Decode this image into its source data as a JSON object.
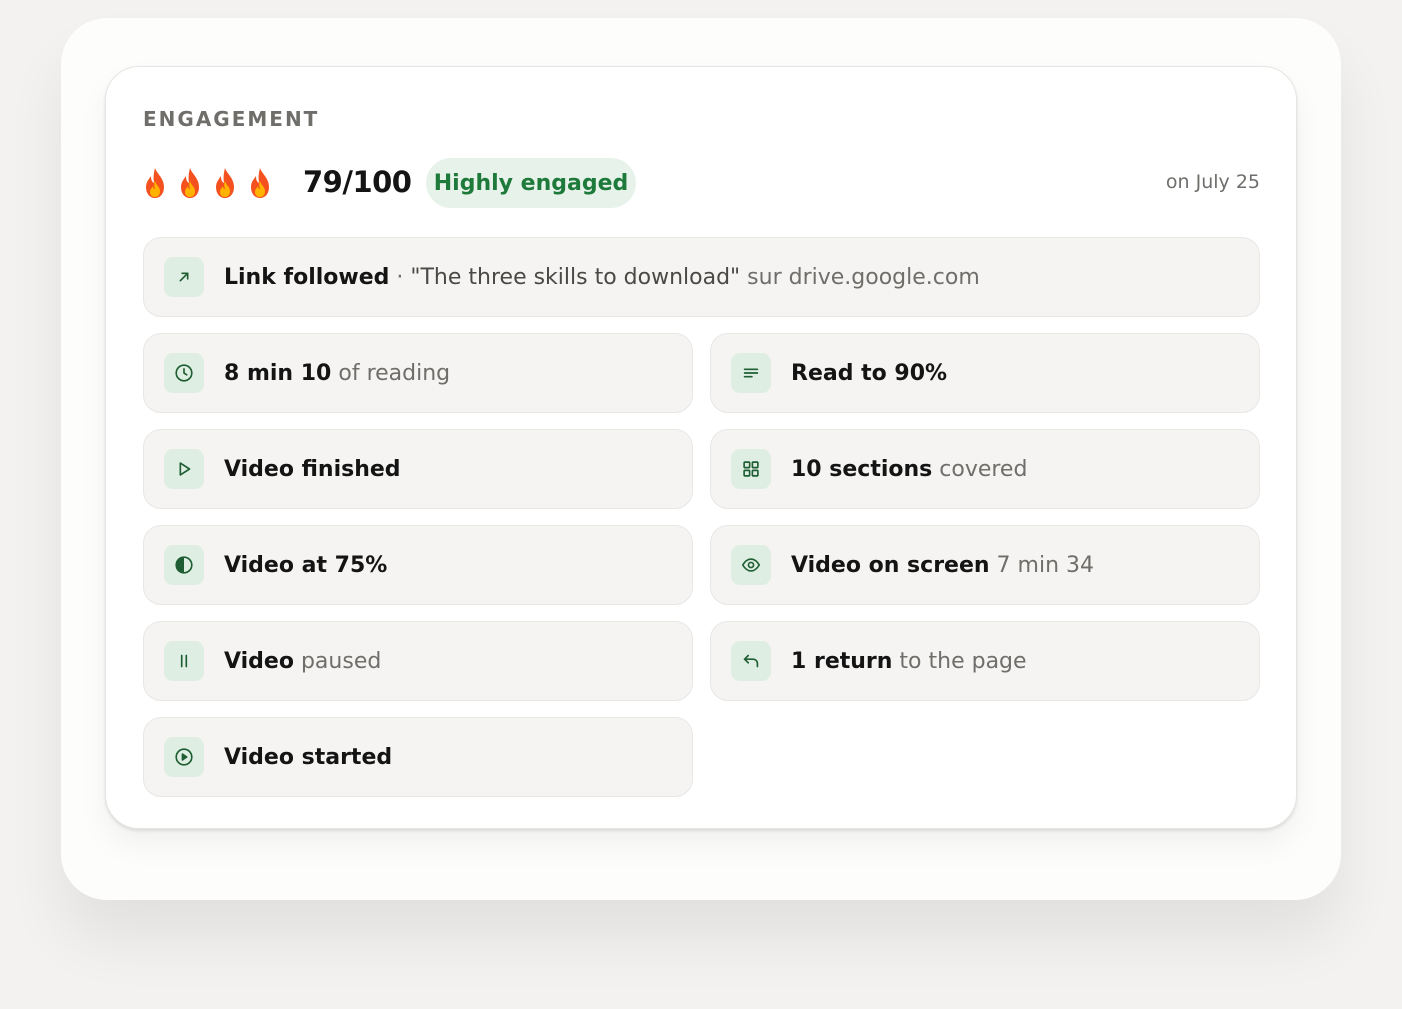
{
  "engagement": {
    "label": "ENGAGEMENT",
    "flames": [
      "fire-icon",
      "fire-icon",
      "fire-icon",
      "fire-icon"
    ],
    "score": "79/100",
    "badge": "Highly engaged",
    "date": "on July 25"
  },
  "link": {
    "icon": "arrow-up-right-icon",
    "label": "Link followed",
    "separator": " · ",
    "quote": "\"The three skills to download\"",
    "suffix": " sur drive.google.com"
  },
  "items": [
    {
      "icon": "clock-icon",
      "bold": "8 min 10",
      "rest": " of reading"
    },
    {
      "icon": "lines-icon",
      "bold": "Read to 90%",
      "rest": ""
    },
    {
      "icon": "play-icon",
      "bold": "Video finished",
      "rest": ""
    },
    {
      "icon": "grid-icon",
      "bold": "10 sections",
      "rest": " covered"
    },
    {
      "icon": "half-circle-icon",
      "bold": "Video at 75%",
      "rest": ""
    },
    {
      "icon": "eye-icon",
      "bold": "Video on screen",
      "rest": " 7 min 34"
    },
    {
      "icon": "pause-icon",
      "bold": "Video",
      "rest": " paused"
    },
    {
      "icon": "return-arrow-icon",
      "bold": "1 return",
      "rest": " to the page"
    },
    {
      "icon": "play-circle-icon",
      "bold": "Video started",
      "rest": ""
    }
  ],
  "colors": {
    "accent": "#1e7a3a",
    "badge_bg": "#e7f3ea",
    "icon_bg": "#dfeee2",
    "row_bg": "#f5f4f2",
    "text": "#141414",
    "muted": "#6f6e6b"
  }
}
